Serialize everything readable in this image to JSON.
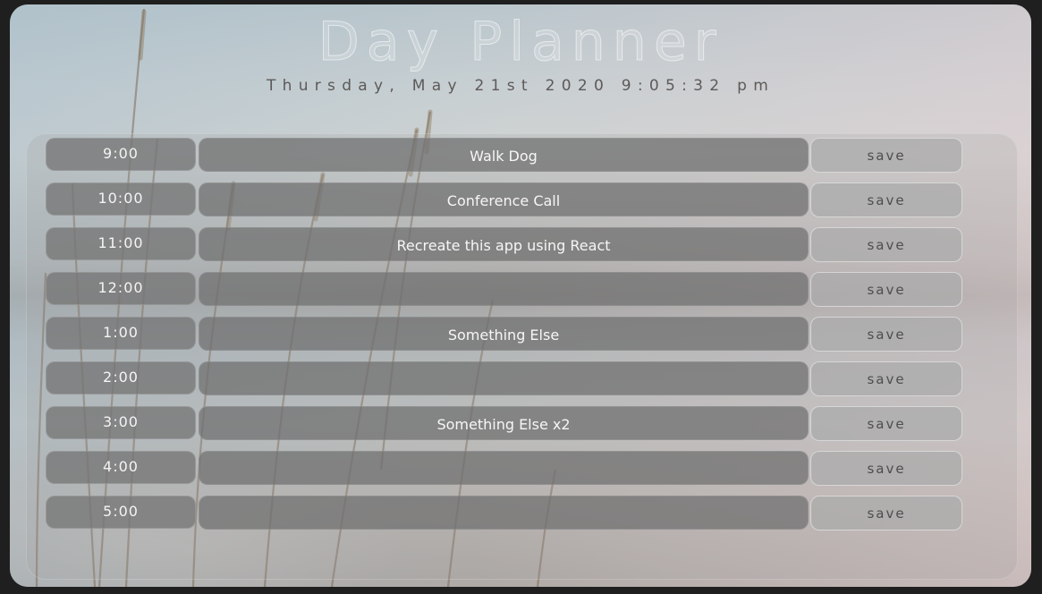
{
  "header": {
    "title": "Day Planner",
    "date": "Thursday, May 21st 2020 9:05:32 pm"
  },
  "planner": {
    "rows": [
      {
        "hour": "9:00",
        "task": "Walk Dog",
        "save_label": "save"
      },
      {
        "hour": "10:00",
        "task": "Conference Call",
        "save_label": "save"
      },
      {
        "hour": "11:00",
        "task": "Recreate this app using React",
        "save_label": "save"
      },
      {
        "hour": "12:00",
        "task": "",
        "save_label": "save"
      },
      {
        "hour": "1:00",
        "task": "Something Else",
        "save_label": "save"
      },
      {
        "hour": "2:00",
        "task": "",
        "save_label": "save"
      },
      {
        "hour": "3:00",
        "task": "Something Else x2",
        "save_label": "save"
      },
      {
        "hour": "4:00",
        "task": "",
        "save_label": "save"
      },
      {
        "hour": "5:00",
        "task": "",
        "save_label": "save"
      }
    ]
  },
  "colors": {
    "page_background": "#1f1f1f",
    "hour_block": "#767676",
    "task_block": "#707070",
    "save_button": "#aaaaaa",
    "save_text": "#4e4e4e"
  }
}
